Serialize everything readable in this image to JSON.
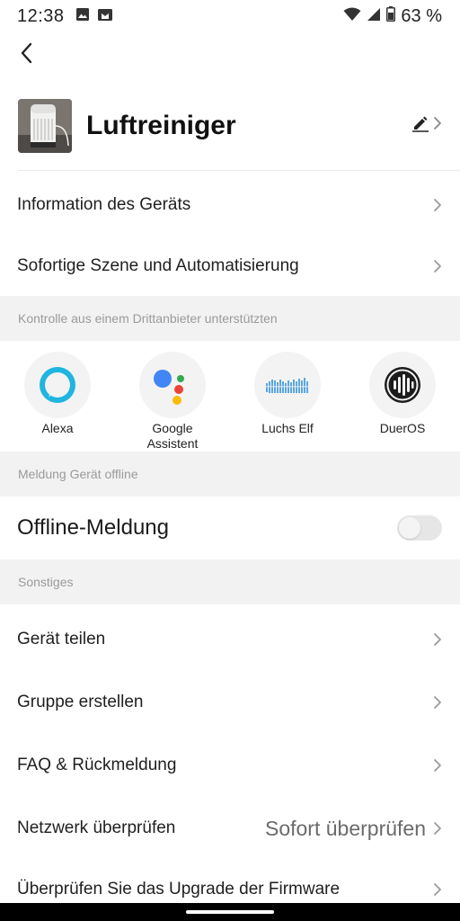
{
  "status_bar": {
    "time": "12:38",
    "battery": "63 %",
    "icons": [
      "image-icon",
      "mail-icon",
      "wifi-icon",
      "signal-icon",
      "battery-icon"
    ]
  },
  "header": {
    "back_icon": "chevron-left-icon",
    "device_name": "Luftreiniger",
    "edit_icon": "pencil-icon"
  },
  "menu_top": [
    {
      "label": "Information des Geräts"
    },
    {
      "label": "Sofortige Szene und Automatisierung"
    }
  ],
  "third_party": {
    "section_title": "Kontrolle aus einem Drittanbieter unterstützten",
    "items": [
      {
        "label": "Alexa",
        "icon": "alexa-icon"
      },
      {
        "label": "Google Assistent",
        "icon": "google-assistant-icon"
      },
      {
        "label": "Luchs Elf",
        "icon": "luchs-elf-icon"
      },
      {
        "label": "DuerOS",
        "icon": "dueros-icon"
      }
    ]
  },
  "offline": {
    "section_title": "Meldung Gerät offline",
    "label": "Offline-Meldung",
    "enabled": false
  },
  "other": {
    "section_title": "Sonstiges",
    "items": [
      {
        "label": "Gerät teilen"
      },
      {
        "label": "Gruppe erstellen"
      },
      {
        "label": "FAQ & Rückmeldung"
      },
      {
        "label": "Netzwerk überprüfen",
        "value": "Sofort überprüfen"
      },
      {
        "label": "Überprüfen Sie das Upgrade der Firmware"
      }
    ]
  },
  "colors": {
    "section_bg": "#f2f2f2",
    "section_text": "#9a9a9a",
    "alexa_blue": "#1fb5e0",
    "google_blue": "#4285f4",
    "google_red": "#ea4335",
    "google_yellow": "#fbbc05",
    "google_green": "#34a853"
  }
}
